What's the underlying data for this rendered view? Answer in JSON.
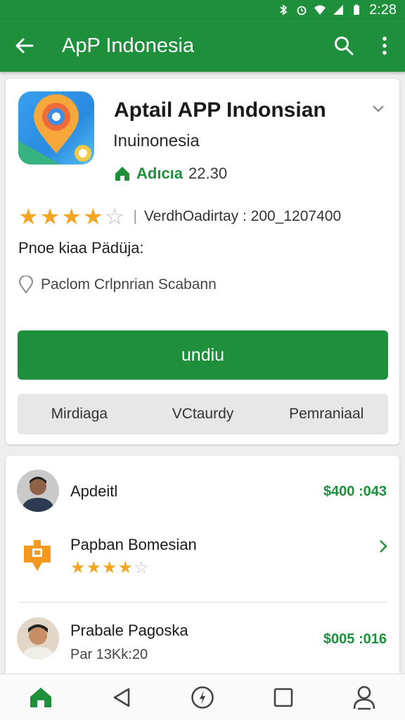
{
  "status_bar": {
    "time": "2:28"
  },
  "app_bar": {
    "title": "ApP Indonesia"
  },
  "app": {
    "name": "Aptail APP Indonsian",
    "subtitle": "Inuinonesia",
    "developer": "Adıcıa",
    "developer_number": "22.30",
    "rating": 4,
    "rating_max": 5,
    "version_text": "VerdhOadirtay : 200_1207400",
    "section_label": "Pnoe kiaa Pädüja:",
    "location_text": "Paclom Crlpnrian Scabann",
    "install_label": "undiu",
    "tabs": [
      "Mirdiaga",
      "VCtaurdy",
      "Pemraniaal"
    ]
  },
  "list": {
    "items": [
      {
        "title": "Apdeitl",
        "price": "$400 :043"
      },
      {
        "title": "Papban Bomesian",
        "rating": 4
      },
      {
        "title": "Prabale Pagoska",
        "subtitle": "Par 13Kk:20",
        "price": "$005 :016"
      }
    ]
  },
  "colors": {
    "accent": "#1e8f3a",
    "star": "#f5a524"
  },
  "icons": [
    "bluetooth-icon",
    "alarm-icon",
    "wifi-icon",
    "signal-icon",
    "battery-icon",
    "back-arrow-icon",
    "search-icon",
    "more-vert-icon",
    "chevron-down-icon",
    "home-icon",
    "location-pin-icon",
    "chevron-right-icon",
    "nav-home-icon",
    "nav-back-icon",
    "nav-compass-icon",
    "nav-square-icon",
    "nav-profile-icon"
  ]
}
